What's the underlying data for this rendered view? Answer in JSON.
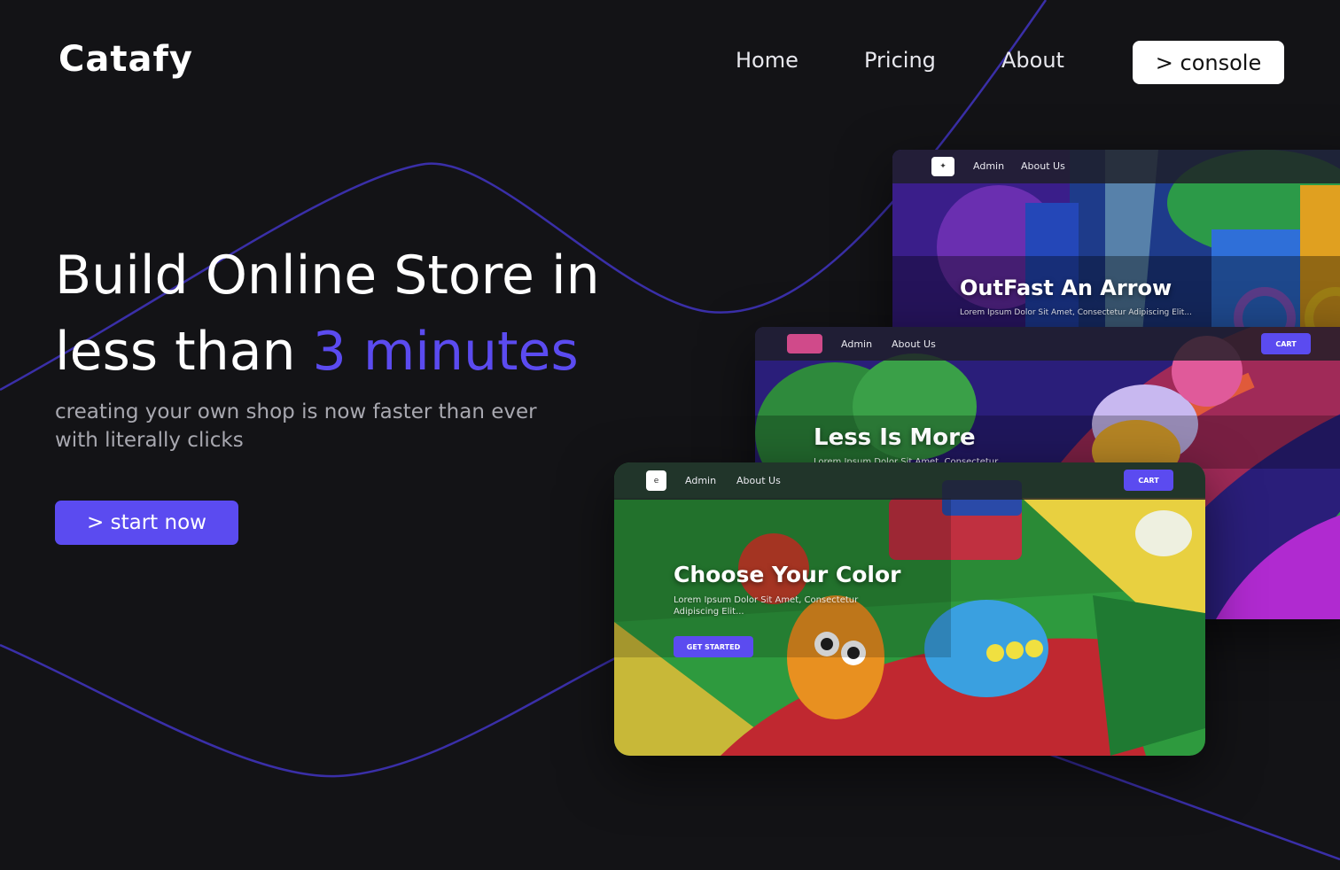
{
  "brand": {
    "logo_text": "Catafy",
    "accent_color": "#5b4bf0",
    "background_color": "#131316"
  },
  "nav": {
    "home": "Home",
    "pricing": "Pricing",
    "about": "About",
    "console": "> console"
  },
  "hero": {
    "title_line1": "Build Online Store in",
    "title_line2_prefix": "less than ",
    "title_line2_accent": "3 minutes",
    "subtitle": "creating your own shop is now faster than ever with literally clicks",
    "cta": "> start now"
  },
  "previews": [
    {
      "nav_links": [
        "Admin",
        "About Us"
      ],
      "heading": "OutFast An Arrow",
      "description": "Lorem Ipsum Dolor Sit Amet, Consectetur Adipiscing Elit..."
    },
    {
      "nav_links": [
        "Admin",
        "About Us"
      ],
      "cart": "CART",
      "heading": "Less Is More",
      "description": "Lorem Ipsum Dolor Sit Amet, Consectetur"
    },
    {
      "nav_links": [
        "Admin",
        "About Us"
      ],
      "cart": "CART",
      "heading": "Choose Your Color",
      "description": "Lorem Ipsum Dolor Sit Amet, Consectetur Adipiscing Elit...",
      "cta": "GET STARTED"
    }
  ]
}
